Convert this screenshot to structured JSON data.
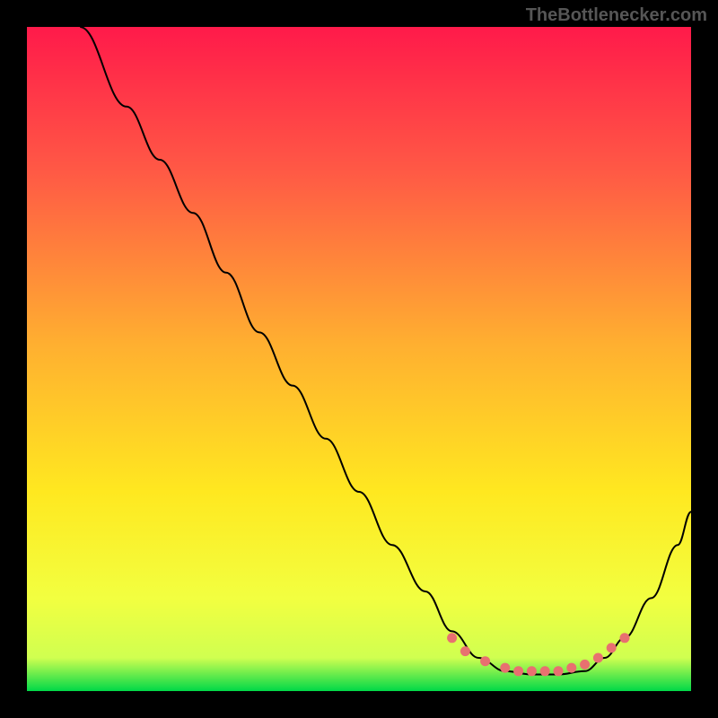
{
  "attribution": "TheBottlenecker.com",
  "chart_data": {
    "type": "line",
    "title": "",
    "xlabel": "",
    "ylabel": "",
    "xlim": [
      0,
      100
    ],
    "ylim": [
      0,
      100
    ],
    "gradient_colors": {
      "top": "#ff1a4a",
      "mid1": "#ff6040",
      "mid2": "#ffaa30",
      "mid3": "#ffe020",
      "mid4": "#f5ff30",
      "bottom": "#00e050"
    },
    "curve": [
      {
        "x": 8,
        "y": 100
      },
      {
        "x": 15,
        "y": 88
      },
      {
        "x": 20,
        "y": 80
      },
      {
        "x": 25,
        "y": 72
      },
      {
        "x": 30,
        "y": 63
      },
      {
        "x": 35,
        "y": 54
      },
      {
        "x": 40,
        "y": 46
      },
      {
        "x": 45,
        "y": 38
      },
      {
        "x": 50,
        "y": 30
      },
      {
        "x": 55,
        "y": 22
      },
      {
        "x": 60,
        "y": 15
      },
      {
        "x": 64,
        "y": 9
      },
      {
        "x": 68,
        "y": 5
      },
      {
        "x": 72,
        "y": 3
      },
      {
        "x": 76,
        "y": 2.5
      },
      {
        "x": 80,
        "y": 2.5
      },
      {
        "x": 84,
        "y": 3
      },
      {
        "x": 87,
        "y": 5
      },
      {
        "x": 90,
        "y": 8
      },
      {
        "x": 94,
        "y": 14
      },
      {
        "x": 98,
        "y": 22
      },
      {
        "x": 100,
        "y": 27
      }
    ],
    "dots": [
      {
        "x": 64,
        "y": 8
      },
      {
        "x": 66,
        "y": 6
      },
      {
        "x": 69,
        "y": 4.5
      },
      {
        "x": 72,
        "y": 3.5
      },
      {
        "x": 74,
        "y": 3
      },
      {
        "x": 76,
        "y": 3
      },
      {
        "x": 78,
        "y": 3
      },
      {
        "x": 80,
        "y": 3
      },
      {
        "x": 82,
        "y": 3.5
      },
      {
        "x": 84,
        "y": 4
      },
      {
        "x": 86,
        "y": 5
      },
      {
        "x": 88,
        "y": 6.5
      },
      {
        "x": 90,
        "y": 8
      }
    ],
    "dot_color": "#e87070"
  }
}
